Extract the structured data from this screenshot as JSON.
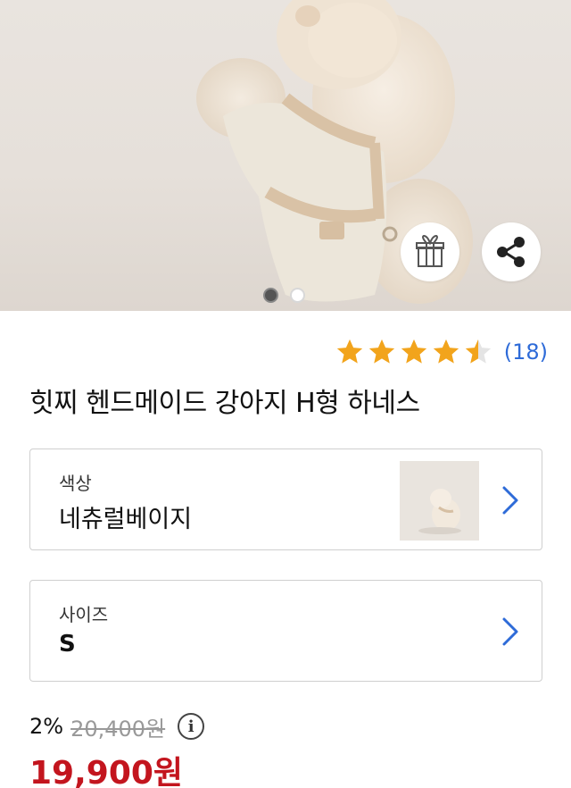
{
  "product": {
    "title": "힛찌 헨드메이드 강아지 H형 하네스",
    "rating": 4.5,
    "review_count": "(18)"
  },
  "hero": {
    "slide_count": 2,
    "active_slide": 1
  },
  "options": {
    "color": {
      "label": "색상",
      "value": "네츄럴베이지"
    },
    "size": {
      "label": "사이즈",
      "value": "S"
    }
  },
  "price": {
    "discount": "2%",
    "original": "20,400원",
    "final": "19,900원"
  },
  "colors": {
    "star": "#f2a41c",
    "link": "#2e6bd8",
    "price": "#c3151e",
    "chevron": "#2e6bd8"
  },
  "icons": {
    "gift": "gift-icon",
    "share": "share-icon",
    "info": "info-icon",
    "chevron": "chevron-right-icon"
  }
}
